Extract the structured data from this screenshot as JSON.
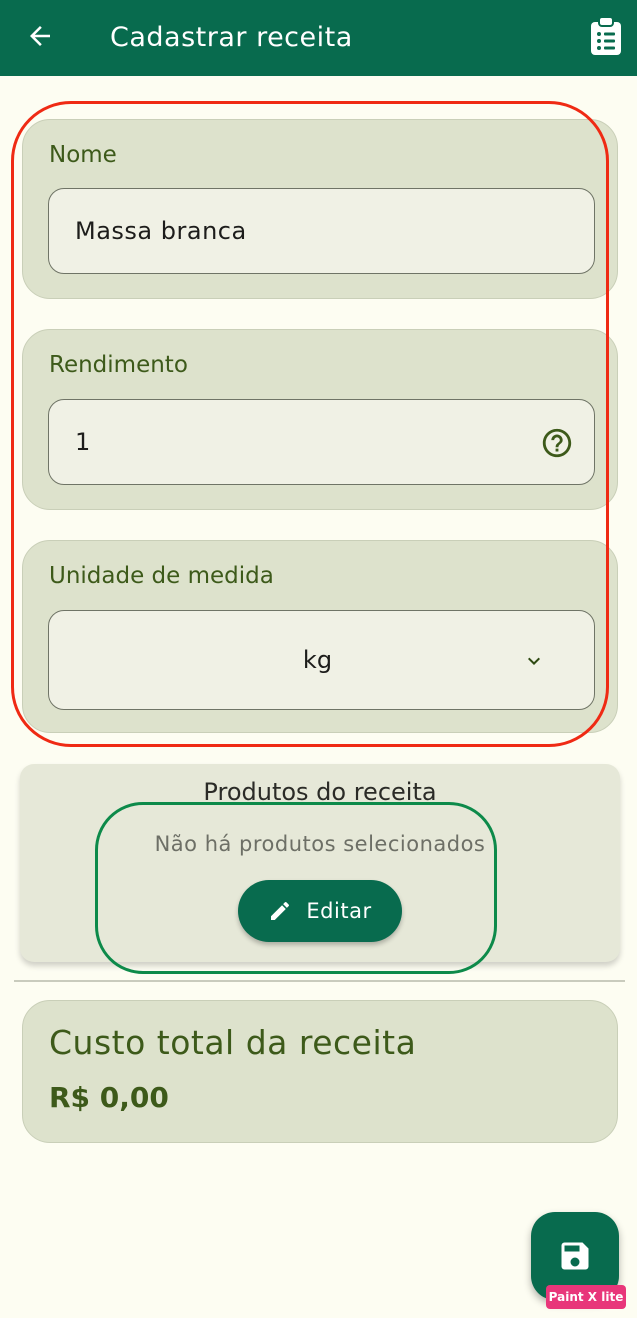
{
  "appbar": {
    "title": "Cadastrar receita",
    "back_icon": "arrow-left-icon",
    "action_icon": "clipboard-list-icon",
    "color": "#086b4e"
  },
  "form": {
    "name": {
      "label": "Nome",
      "value": "Massa branca"
    },
    "yield": {
      "label": "Rendimento",
      "value": "1",
      "help_icon": "help-circle-icon"
    },
    "unit": {
      "label": "Unidade de medida",
      "value": "kg",
      "dropdown_icon": "chevron-down-icon"
    }
  },
  "products": {
    "title": "Produtos do receita",
    "empty_message": "Não há produtos selecionados",
    "edit_label": "Editar",
    "edit_icon": "pencil-icon"
  },
  "cost": {
    "title": "Custo total da receita",
    "value": "R$ 0,00"
  },
  "fab": {
    "icon": "save-icon"
  },
  "watermark": {
    "text": "Paint X lite"
  },
  "annotations": {
    "red": "#ef2a14",
    "green": "#0d8a4a"
  }
}
